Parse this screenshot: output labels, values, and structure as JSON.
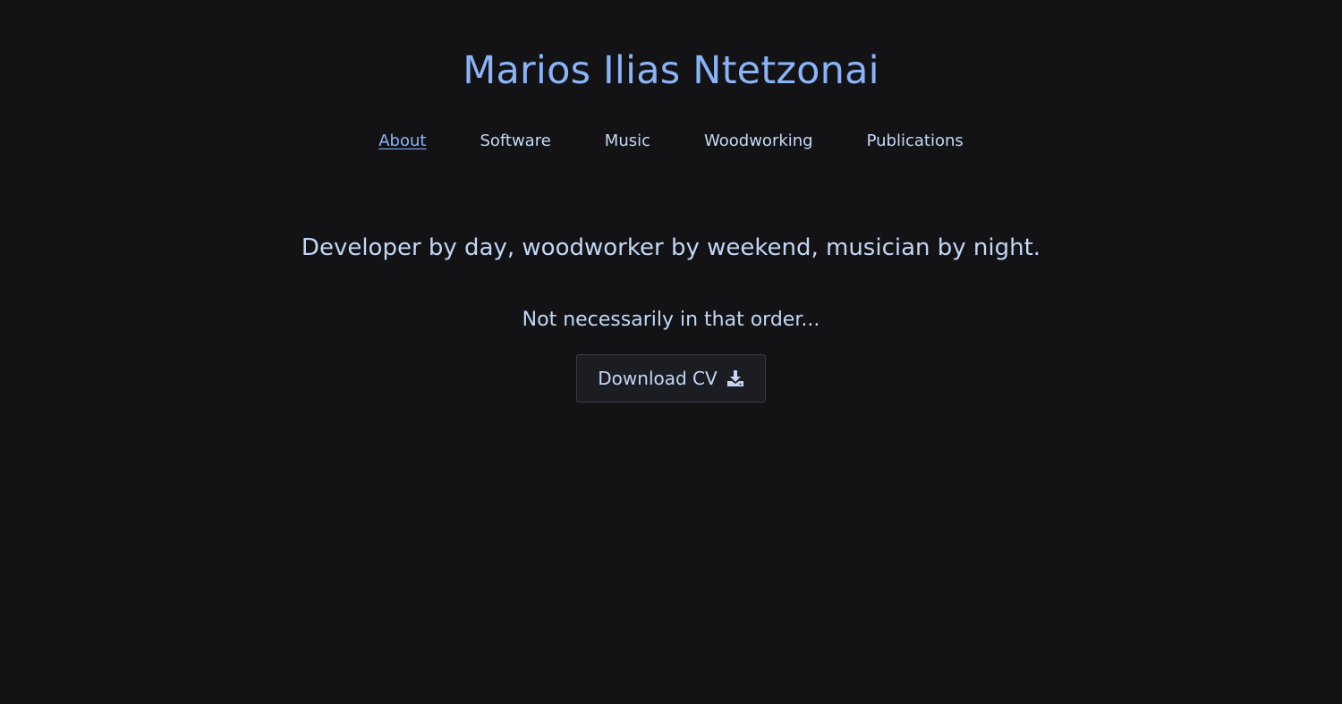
{
  "header": {
    "title": "Marios Ilias Ntetzonai"
  },
  "nav": {
    "items": [
      {
        "label": "About",
        "active": true
      },
      {
        "label": "Software",
        "active": false
      },
      {
        "label": "Music",
        "active": false
      },
      {
        "label": "Woodworking",
        "active": false
      },
      {
        "label": "Publications",
        "active": false
      }
    ]
  },
  "main": {
    "tagline": "Developer by day, woodworker by weekend, musician by night.",
    "subtagline": "Not necessarily in that order...",
    "cv_button": {
      "label": "Download CV",
      "icon": "download-icon"
    }
  },
  "colors": {
    "background": "#131316",
    "accent": "#8ab4f8",
    "text": "#c3d7f5"
  }
}
